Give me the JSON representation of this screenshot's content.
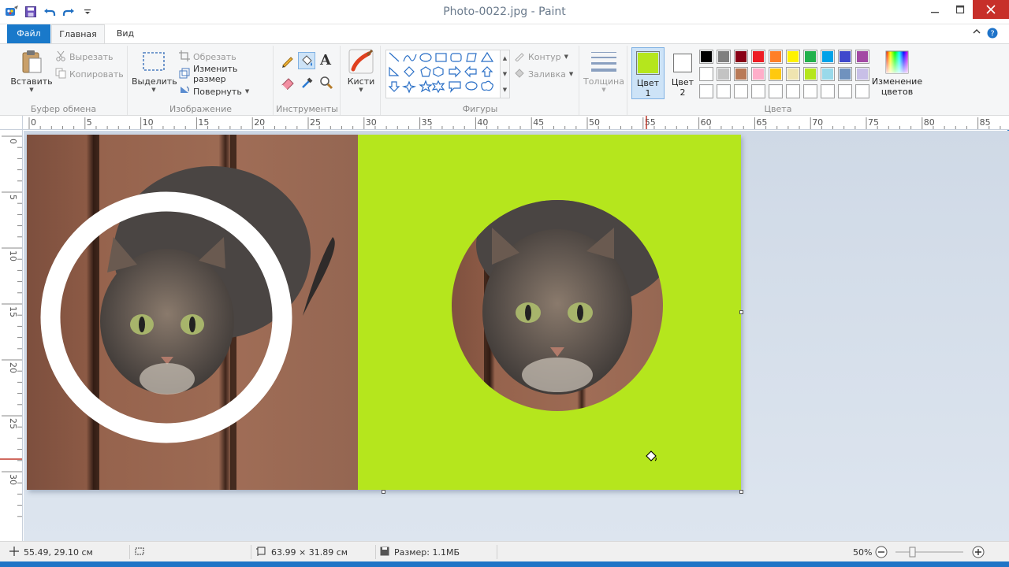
{
  "window": {
    "title": "Photo-0022.jpg - Paint",
    "controls": [
      "minimize",
      "maximize",
      "close"
    ]
  },
  "tabs": {
    "file": "Файл",
    "home": "Главная",
    "view": "Вид"
  },
  "ribbon": {
    "clipboard": {
      "label": "Буфер обмена",
      "paste": "Вставить",
      "cut": "Вырезать",
      "copy": "Копировать"
    },
    "image": {
      "label": "Изображение",
      "select": "Выделить",
      "crop": "Обрезать",
      "resize": "Изменить размер",
      "rotate": "Повернуть"
    },
    "tools": {
      "label": "Инструменты",
      "text_glyph": "A"
    },
    "brushes": {
      "label": "Кисти"
    },
    "shapes": {
      "label": "Фигуры",
      "outline": "Контур",
      "fill": "Заливка"
    },
    "size": {
      "label": "Толщина"
    },
    "colors": {
      "label": "Цвета",
      "color1_label": "Цвет",
      "color1_num": "1",
      "color2_label": "Цвет",
      "color2_num": "2",
      "color1": "#b5e61d",
      "color2": "#ffffff",
      "edit_colors_line1": "Изменение",
      "edit_colors_line2": "цветов",
      "palette_row1": [
        "#000000",
        "#7f7f7f",
        "#880015",
        "#ed1c24",
        "#ff7f27",
        "#fff200",
        "#22b14c",
        "#00a2e8",
        "#3f48cc",
        "#a349a4"
      ],
      "palette_row2": [
        "#ffffff",
        "#c3c3c3",
        "#b97a57",
        "#ffaec9",
        "#ffc90e",
        "#efe4b0",
        "#b5e61d",
        "#99d9ea",
        "#7092be",
        "#c8bfe7"
      ],
      "palette_row3": [
        "#ffffff",
        "#ffffff",
        "#ffffff",
        "#ffffff",
        "#ffffff",
        "#ffffff",
        "#ffffff",
        "#ffffff",
        "#ffffff",
        "#ffffff"
      ]
    }
  },
  "ruler": {
    "h_ticks": [
      "0",
      "5",
      "10",
      "15",
      "20",
      "25",
      "30",
      "35",
      "40",
      "45",
      "50",
      "55",
      "60",
      "65",
      "70",
      "75",
      "80",
      "85"
    ],
    "v_ticks": [
      "0",
      "5",
      "10",
      "15",
      "20",
      "25",
      "30"
    ]
  },
  "canvas": {
    "background_color": "#b5e61d",
    "ring_color": "#ffffff"
  },
  "status": {
    "cursor_pos": "55.49, 29.10 см",
    "selection_size": "",
    "image_size": "63.99 × 31.89 см",
    "file_size": "Размер: 1.1МБ",
    "zoom": "50%",
    "zoom_fraction": 0.5
  }
}
